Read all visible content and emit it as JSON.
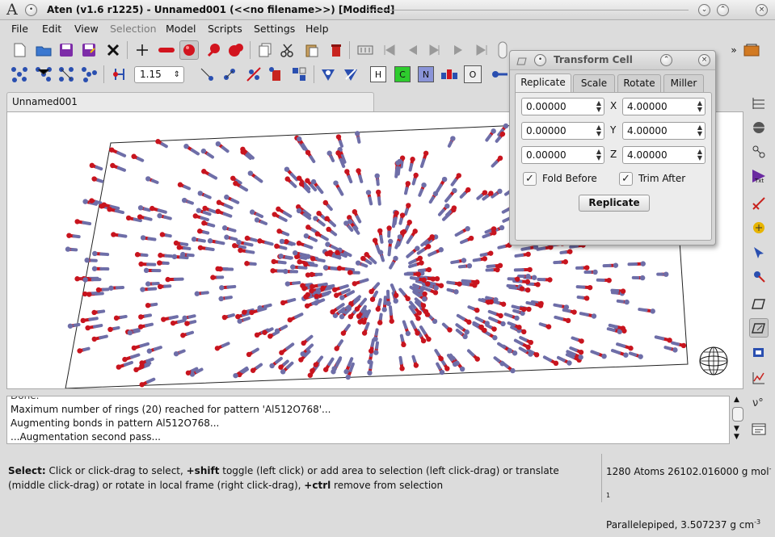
{
  "window": {
    "title": "Aten (v1.6 r1225) - Unnamed001 (<<no filename>>) [Modified]",
    "logo_text": "A"
  },
  "menu": [
    "File",
    "Edit",
    "View",
    "Selection",
    "Model",
    "Scripts",
    "Settings",
    "Help"
  ],
  "toolbar": {
    "bond_tolerance": "1.15",
    "element_buttons": [
      "H",
      "C",
      "N",
      "O"
    ],
    "overflow": "»"
  },
  "model_tab": {
    "label": "Unnamed001"
  },
  "dialog": {
    "title": "Transform Cell",
    "tabs": [
      "Replicate",
      "Scale",
      "Rotate",
      "Miller"
    ],
    "active_tab": "Replicate",
    "rows": [
      {
        "neg": "0.00000",
        "axis": "X",
        "pos": "4.00000"
      },
      {
        "neg": "0.00000",
        "axis": "Y",
        "pos": "4.00000"
      },
      {
        "neg": "0.00000",
        "axis": "Z",
        "pos": "4.00000"
      }
    ],
    "fold_before": {
      "label": "Fold Before",
      "checked": true
    },
    "trim_after": {
      "label": "Trim After",
      "checked": true
    },
    "replicate_button": "Replicate"
  },
  "log": {
    "lines": [
      "Done.",
      "Maximum number of rings (20) reached for pattern 'Al512O768'...",
      "Augmenting bonds in pattern Al512O768...",
      "...Augmentation second pass..."
    ]
  },
  "status": {
    "bold_select": "Select:",
    "text_1": " Click or click-drag to select, ",
    "bold_shift": "+shift",
    "text_2": " toggle (left click) or add area to selection (left click-drag) or translate (middle click-drag) or rotate in local frame (right click-drag), ",
    "bold_ctrl": "+ctrl",
    "text_3": " remove from selection",
    "atoms_info": "1280 Atoms 26102.016000 g mol",
    "atoms_sup": "-1",
    "cell_info": "Parallelepiped, 3.507237 g cm",
    "cell_sup": "-3"
  },
  "colors": {
    "oxygen": "#c8141e",
    "aluminium": "#6e6ea8",
    "accent": "#2a4fb0"
  }
}
